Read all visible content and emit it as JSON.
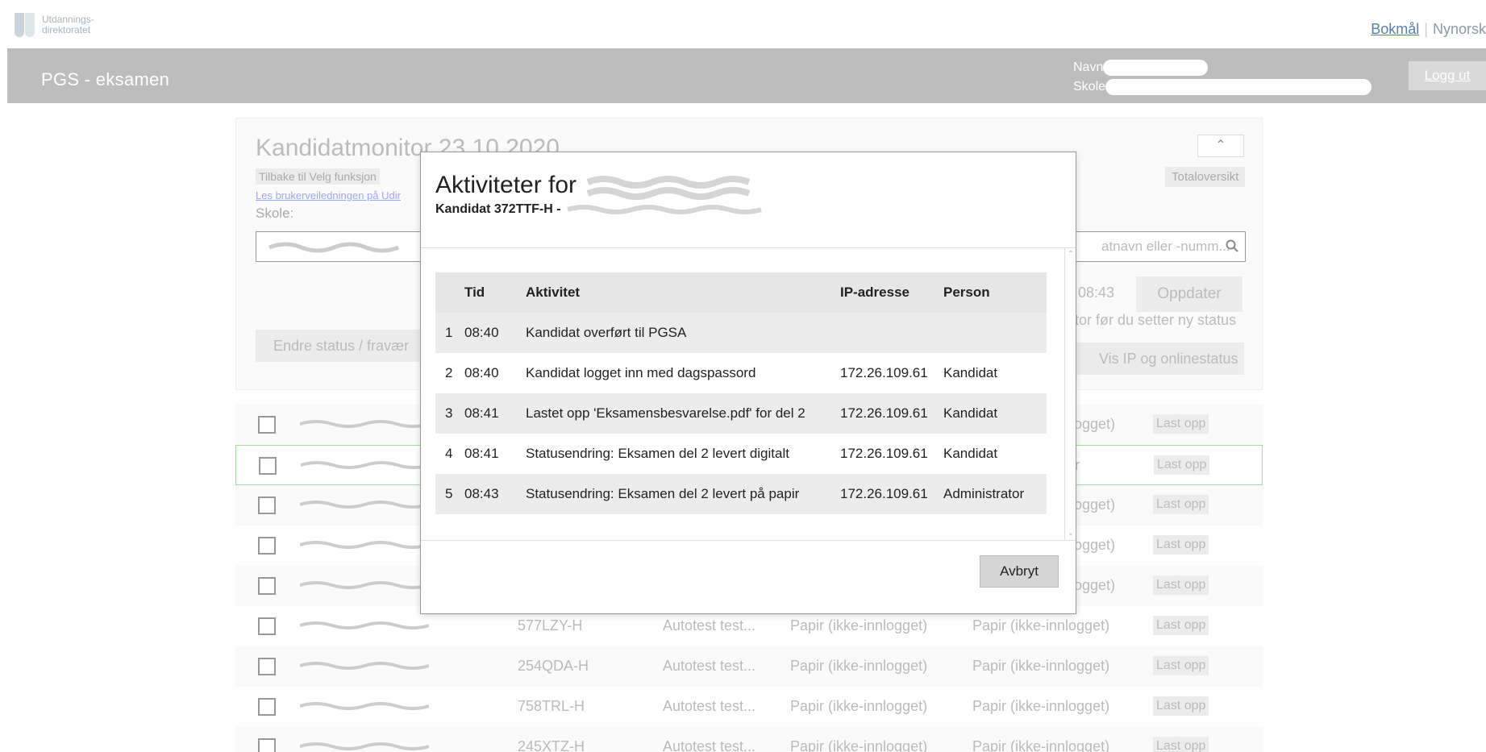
{
  "header": {
    "logo_text_line1": "Utdannings-",
    "logo_text_line2": "direktoratet",
    "lang_bokmal": "Bokmål",
    "lang_separator": "|",
    "lang_nynorsk": "Nynorsk",
    "app_title": "PGS - eksamen",
    "user_name_label": "Navn",
    "school_label": "Skole",
    "logout_label": "Logg ut"
  },
  "panel": {
    "title": "Kandidatmonitor 23.10.2020",
    "back_link": "Tilbake til Velg funksjon",
    "guide_link": "Les brukerveiledningen på Udir",
    "school_label": "Skole:",
    "totaloversikt": "Totaloversikt",
    "search_placeholder": "atnavn eller -numm...",
    "time": "08:43",
    "update_button": "Oppdater",
    "hint": "tor før du setter ny status",
    "ip_status_button": "Vis IP og onlinestatus",
    "change_status_button": "Endre status / fravær"
  },
  "rows": [
    {
      "code": "",
      "name": "",
      "mode": "",
      "status": "ogget)",
      "upload": "Last opp"
    },
    {
      "code": "",
      "name": "",
      "mode": "",
      "status": "r",
      "upload": "Last opp"
    },
    {
      "code": "",
      "name": "",
      "mode": "",
      "status": "ogget)",
      "upload": "Last opp"
    },
    {
      "code": "",
      "name": "",
      "mode": "",
      "status": "ogget)",
      "upload": "Last opp"
    },
    {
      "code": "",
      "name": "",
      "mode": "",
      "status": "ogget)",
      "upload": "Last opp"
    },
    {
      "code": "577LZY-H",
      "name": "Autotest test...",
      "mode": "Papir (ikke-innlogget)",
      "status": "Papir (ikke-innlogget)",
      "upload": "Last opp"
    },
    {
      "code": "254QDA-H",
      "name": "Autotest test...",
      "mode": "Papir (ikke-innlogget)",
      "status": "Papir (ikke-innlogget)",
      "upload": "Last opp"
    },
    {
      "code": "758TRL-H",
      "name": "Autotest test...",
      "mode": "Papir (ikke-innlogget)",
      "status": "Papir (ikke-innlogget)",
      "upload": "Last opp"
    },
    {
      "code": "245XTZ-H",
      "name": "Autotest test...",
      "mode": "Papir (ikke-innlogget)",
      "status": "Papir (ikke-innlogget)",
      "upload": "Last opp"
    }
  ],
  "modal": {
    "title": "Aktiviteter for",
    "subtitle": "Kandidat 372TTF-H -",
    "columns": {
      "nr": "",
      "time": "Tid",
      "activity": "Aktivitet",
      "ip": "IP-adresse",
      "person": "Person"
    },
    "activities": [
      {
        "nr": "1",
        "time": "08:40",
        "activity": "Kandidat overført til PGSA",
        "ip": "",
        "person": ""
      },
      {
        "nr": "2",
        "time": "08:40",
        "activity": "Kandidat logget inn med dagspassord",
        "ip": "172.26.109.61",
        "person": "Kandidat"
      },
      {
        "nr": "3",
        "time": "08:41",
        "activity": "Lastet opp 'Eksamensbesvarelse.pdf' for del 2",
        "ip": "172.26.109.61",
        "person": "Kandidat"
      },
      {
        "nr": "4",
        "time": "08:41",
        "activity": "Statusendring: Eksamen del 2 levert digitalt",
        "ip": "172.26.109.61",
        "person": "Kandidat"
      },
      {
        "nr": "5",
        "time": "08:43",
        "activity": "Statusendring: Eksamen del 2 levert på papir",
        "ip": "172.26.109.61",
        "person": "Administrator"
      }
    ],
    "cancel_button": "Avbryt"
  }
}
